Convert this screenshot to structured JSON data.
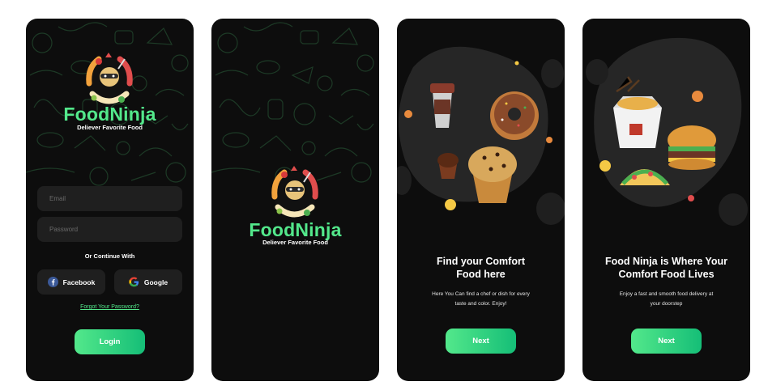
{
  "screens": {
    "login": {
      "brand": "FoodNinja",
      "tagline": "Deliever Favorite Food",
      "email_placeholder": "Email",
      "password_placeholder": "Password",
      "continue_label": "Or Continue With",
      "facebook_label": "Facebook",
      "google_label": "Google",
      "forgot_label": "Forgot Your Password?",
      "login_label": "Login"
    },
    "splash": {
      "brand": "FoodNinja",
      "tagline": "Deliever Favorite Food"
    },
    "onboarding1": {
      "title_line1": "Find your  Comfort",
      "title_line2": "Food here",
      "desc_line1": "Here You Can find a chef or dish for every",
      "desc_line2": "taste and color. Enjoy!",
      "next_label": "Next"
    },
    "onboarding2": {
      "title_line1": "Food Ninja is Where Your",
      "title_line2": "Comfort Food Lives",
      "desc_line1": "Enjoy a fast and smooth food delivery at",
      "desc_line2": "your doorstep",
      "next_label": "Next"
    }
  },
  "colors": {
    "accent": "#53e88b",
    "accent_dark": "#15be77",
    "background": "#0d0d0d",
    "field": "#1f1f1f"
  },
  "icons": [
    "ninja-logo-icon",
    "facebook-icon",
    "google-icon"
  ]
}
